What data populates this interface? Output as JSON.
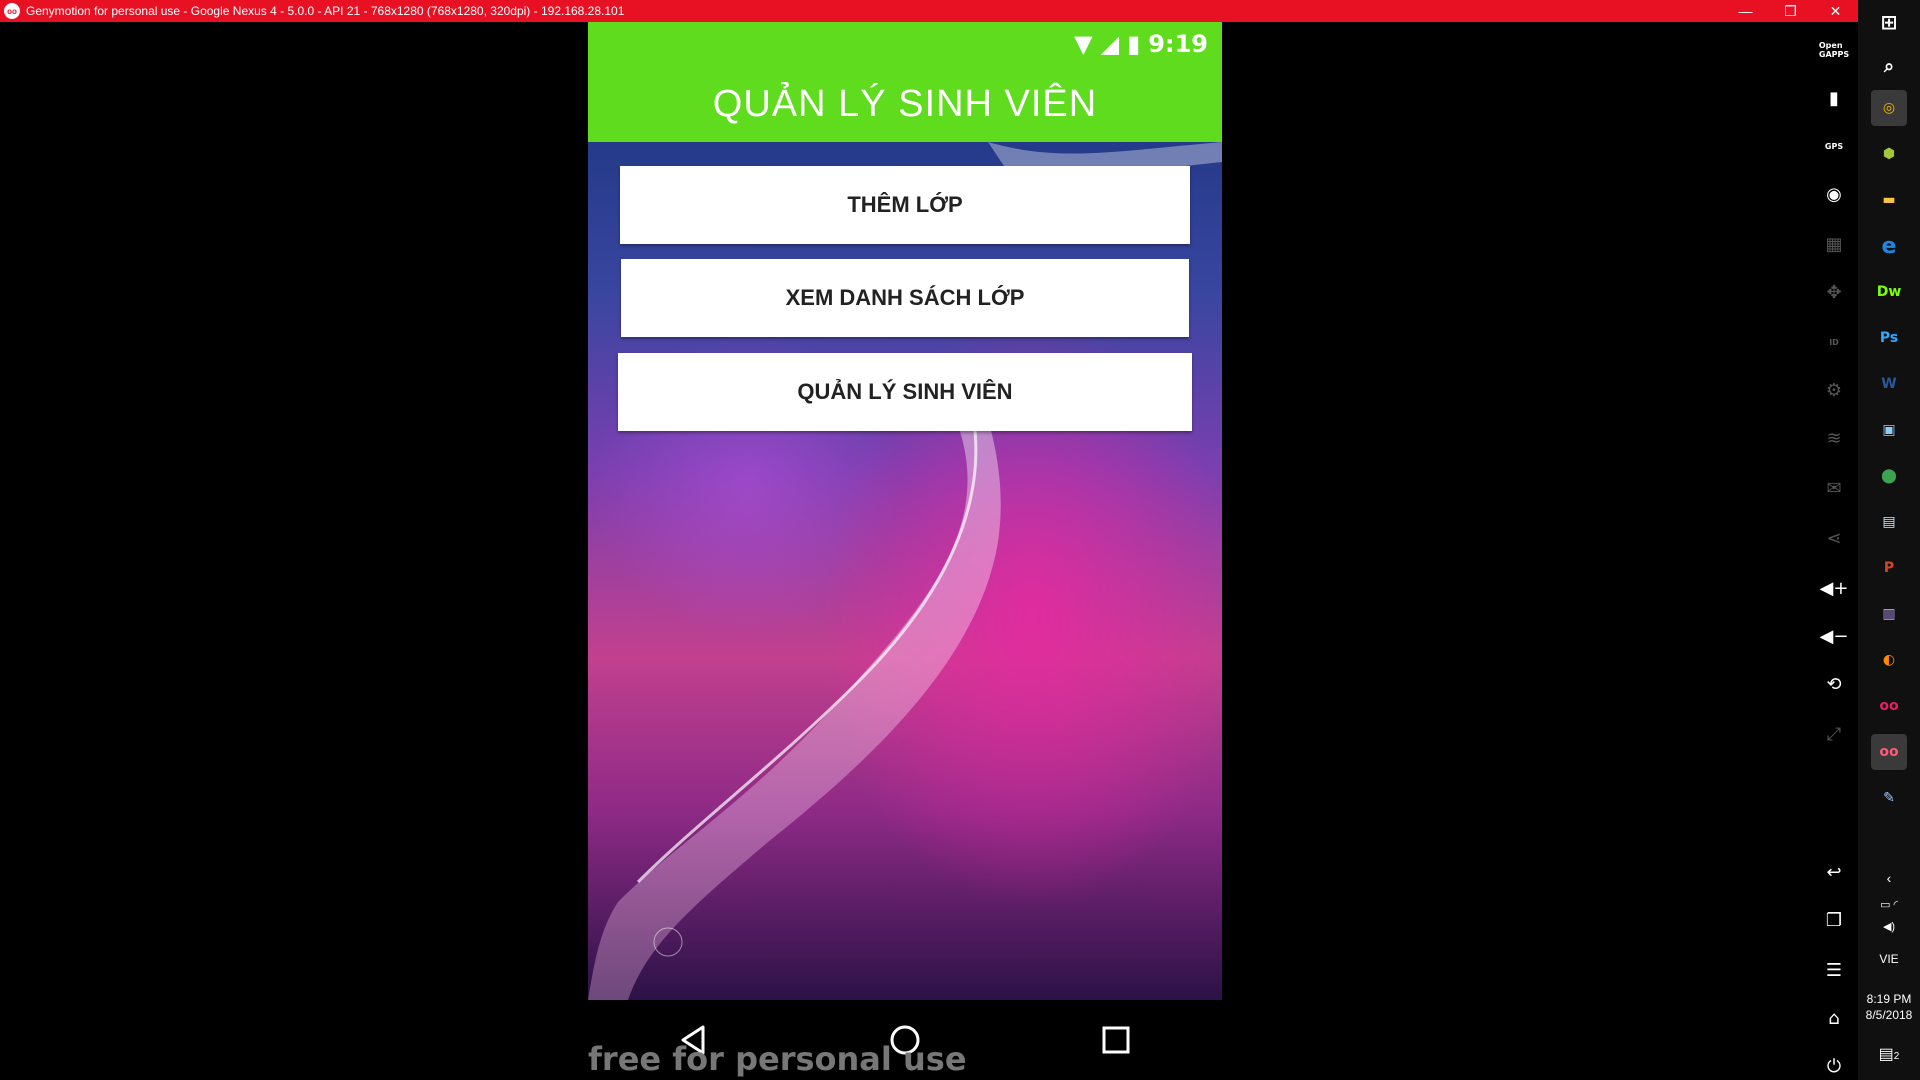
{
  "window": {
    "title": "Genymotion for personal use - Google Nexus 4 - 5.0.0 - API 21 - 768x1280 (768x1280, 320dpi) - 192.168.28.101",
    "logo_text": "oo",
    "minimize": "—",
    "restore": "❐",
    "close": "✕"
  },
  "device": {
    "status_time": "9:19",
    "app_title": "QUẢN LÝ SINH VIÊN",
    "buttons": [
      "THÊM LỚP",
      "XEM DANH SÁCH LỚP",
      "QUẢN LÝ SINH VIÊN"
    ],
    "watermark": "free for personal use",
    "accent_color": "#5fdc1e"
  },
  "toolbar": {
    "open_gapps": "Open GAPPS",
    "gps": "GPS",
    "id": "ID"
  },
  "taskbar": {
    "language": "VIE",
    "time": "8:19 PM",
    "date": "8/5/2018",
    "notifications": "2"
  }
}
